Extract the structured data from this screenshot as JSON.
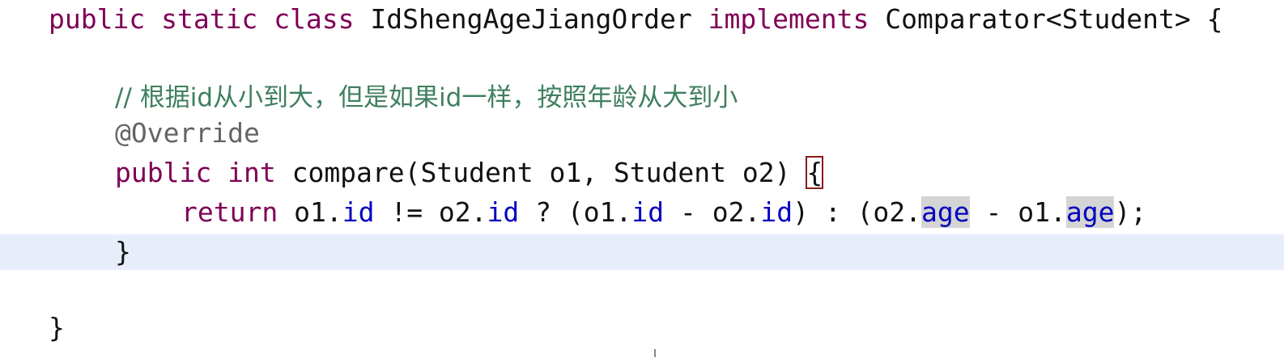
{
  "code": {
    "line1": {
      "kw_public": "public",
      "kw_static": "static",
      "kw_class": "class",
      "class_name": "IdShengAgeJiangOrder",
      "kw_implements": "implements",
      "interface": "Comparator<Student>",
      "open_brace": "{"
    },
    "comment": "// 根据id从小到大，但是如果id一样，按照年龄从大到小",
    "annotation": "@Override",
    "method": {
      "kw_public": "public",
      "kw_int": "int",
      "signature": "compare(Student o1, Student o2)",
      "open_brace": "{"
    },
    "return_line": {
      "kw_return": "return",
      "p1": "o1.",
      "f1": "id",
      "p2": " != o2.",
      "f2": "id",
      "p3": " ? (o1.",
      "f3": "id",
      "p4": " - o2.",
      "f4": "id",
      "p5": ") : (o2.",
      "f5": "age",
      "p6": " - o1.",
      "f6": "age",
      "p7": ");"
    },
    "method_close": "}",
    "class_close": "}"
  },
  "colors": {
    "keyword": "#7f0055",
    "comment": "#3f7f5f",
    "annotation": "#646464",
    "field": "#0000c0",
    "current_line": "#e8eef9"
  }
}
